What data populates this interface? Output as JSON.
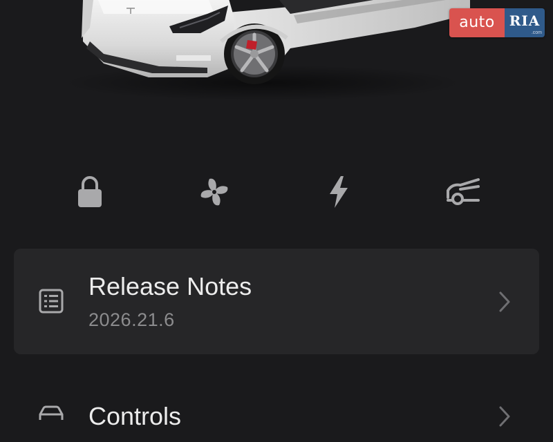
{
  "watermark": {
    "left_text": "auto",
    "right_text": "RIA",
    "domain_text": ".com"
  },
  "quick_controls": [
    {
      "name": "lock",
      "icon": "lock-icon"
    },
    {
      "name": "climate",
      "icon": "fan-icon"
    },
    {
      "name": "charge",
      "icon": "lightning-bolt-icon"
    },
    {
      "name": "frunk",
      "icon": "frunk-open-icon"
    }
  ],
  "menu": {
    "release_notes": {
      "title": "Release Notes",
      "version": "2026.21.6",
      "icon": "list-document-icon"
    },
    "controls": {
      "title": "Controls",
      "icon": "car-icon"
    }
  },
  "colors": {
    "background": "#1a1a1c",
    "card": "#262628",
    "icon": "#a9a9ab",
    "watermark_red": "#d9534f",
    "watermark_blue": "#2f5a8a"
  }
}
